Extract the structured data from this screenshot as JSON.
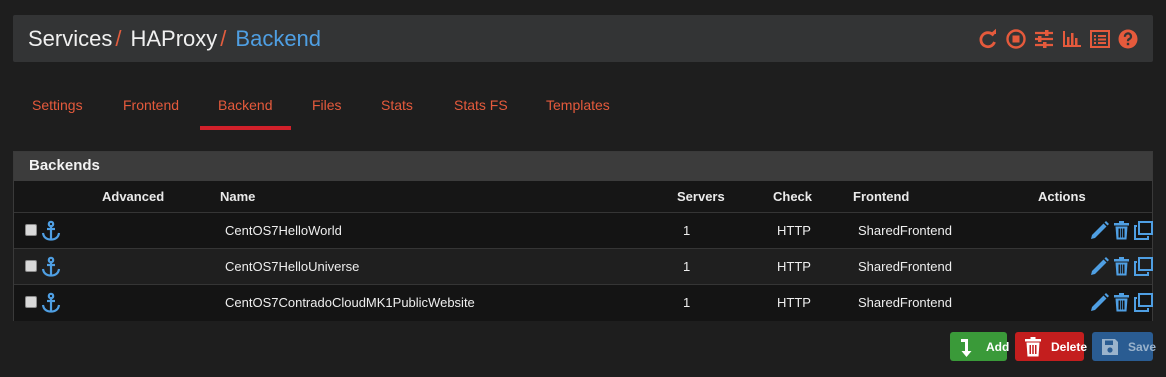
{
  "breadcrumb": {
    "part1": "Services",
    "sep1": "/",
    "part2": "HAProxy",
    "sep2": "/",
    "current": "Backend"
  },
  "header_icons": [
    "restart-icon",
    "stop-icon",
    "settings-sliders-icon",
    "chart-icon",
    "log-list-icon",
    "help-icon"
  ],
  "tabs": [
    {
      "label": "Settings"
    },
    {
      "label": "Frontend"
    },
    {
      "label": "Backend",
      "active": true
    },
    {
      "label": "Files"
    },
    {
      "label": "Stats"
    },
    {
      "label": "Stats FS"
    },
    {
      "label": "Templates"
    }
  ],
  "panel": {
    "title": "Backends",
    "columns": {
      "advanced": "Advanced",
      "name": "Name",
      "servers": "Servers",
      "check": "Check",
      "frontend": "Frontend",
      "actions": "Actions"
    },
    "rows": [
      {
        "name": "CentOS7HelloWorld",
        "servers": "1",
        "check": "HTTP",
        "frontend": "SharedFrontend"
      },
      {
        "name": "CentOS7HelloUniverse",
        "servers": "1",
        "check": "HTTP",
        "frontend": "SharedFrontend"
      },
      {
        "name": "CentOS7ContradoCloudMK1PublicWebsite",
        "servers": "1",
        "check": "HTTP",
        "frontend": "SharedFrontend"
      }
    ]
  },
  "buttons": {
    "add": "Add",
    "delete": "Delete",
    "save": "Save"
  },
  "colors": {
    "accent": "#e55a3c",
    "link_blue": "#4f9fe3",
    "tab_underline": "#d2202a",
    "add_green": "#3a9a39",
    "delete_red": "#c41e1e",
    "save_blue": "#2a5c92"
  }
}
